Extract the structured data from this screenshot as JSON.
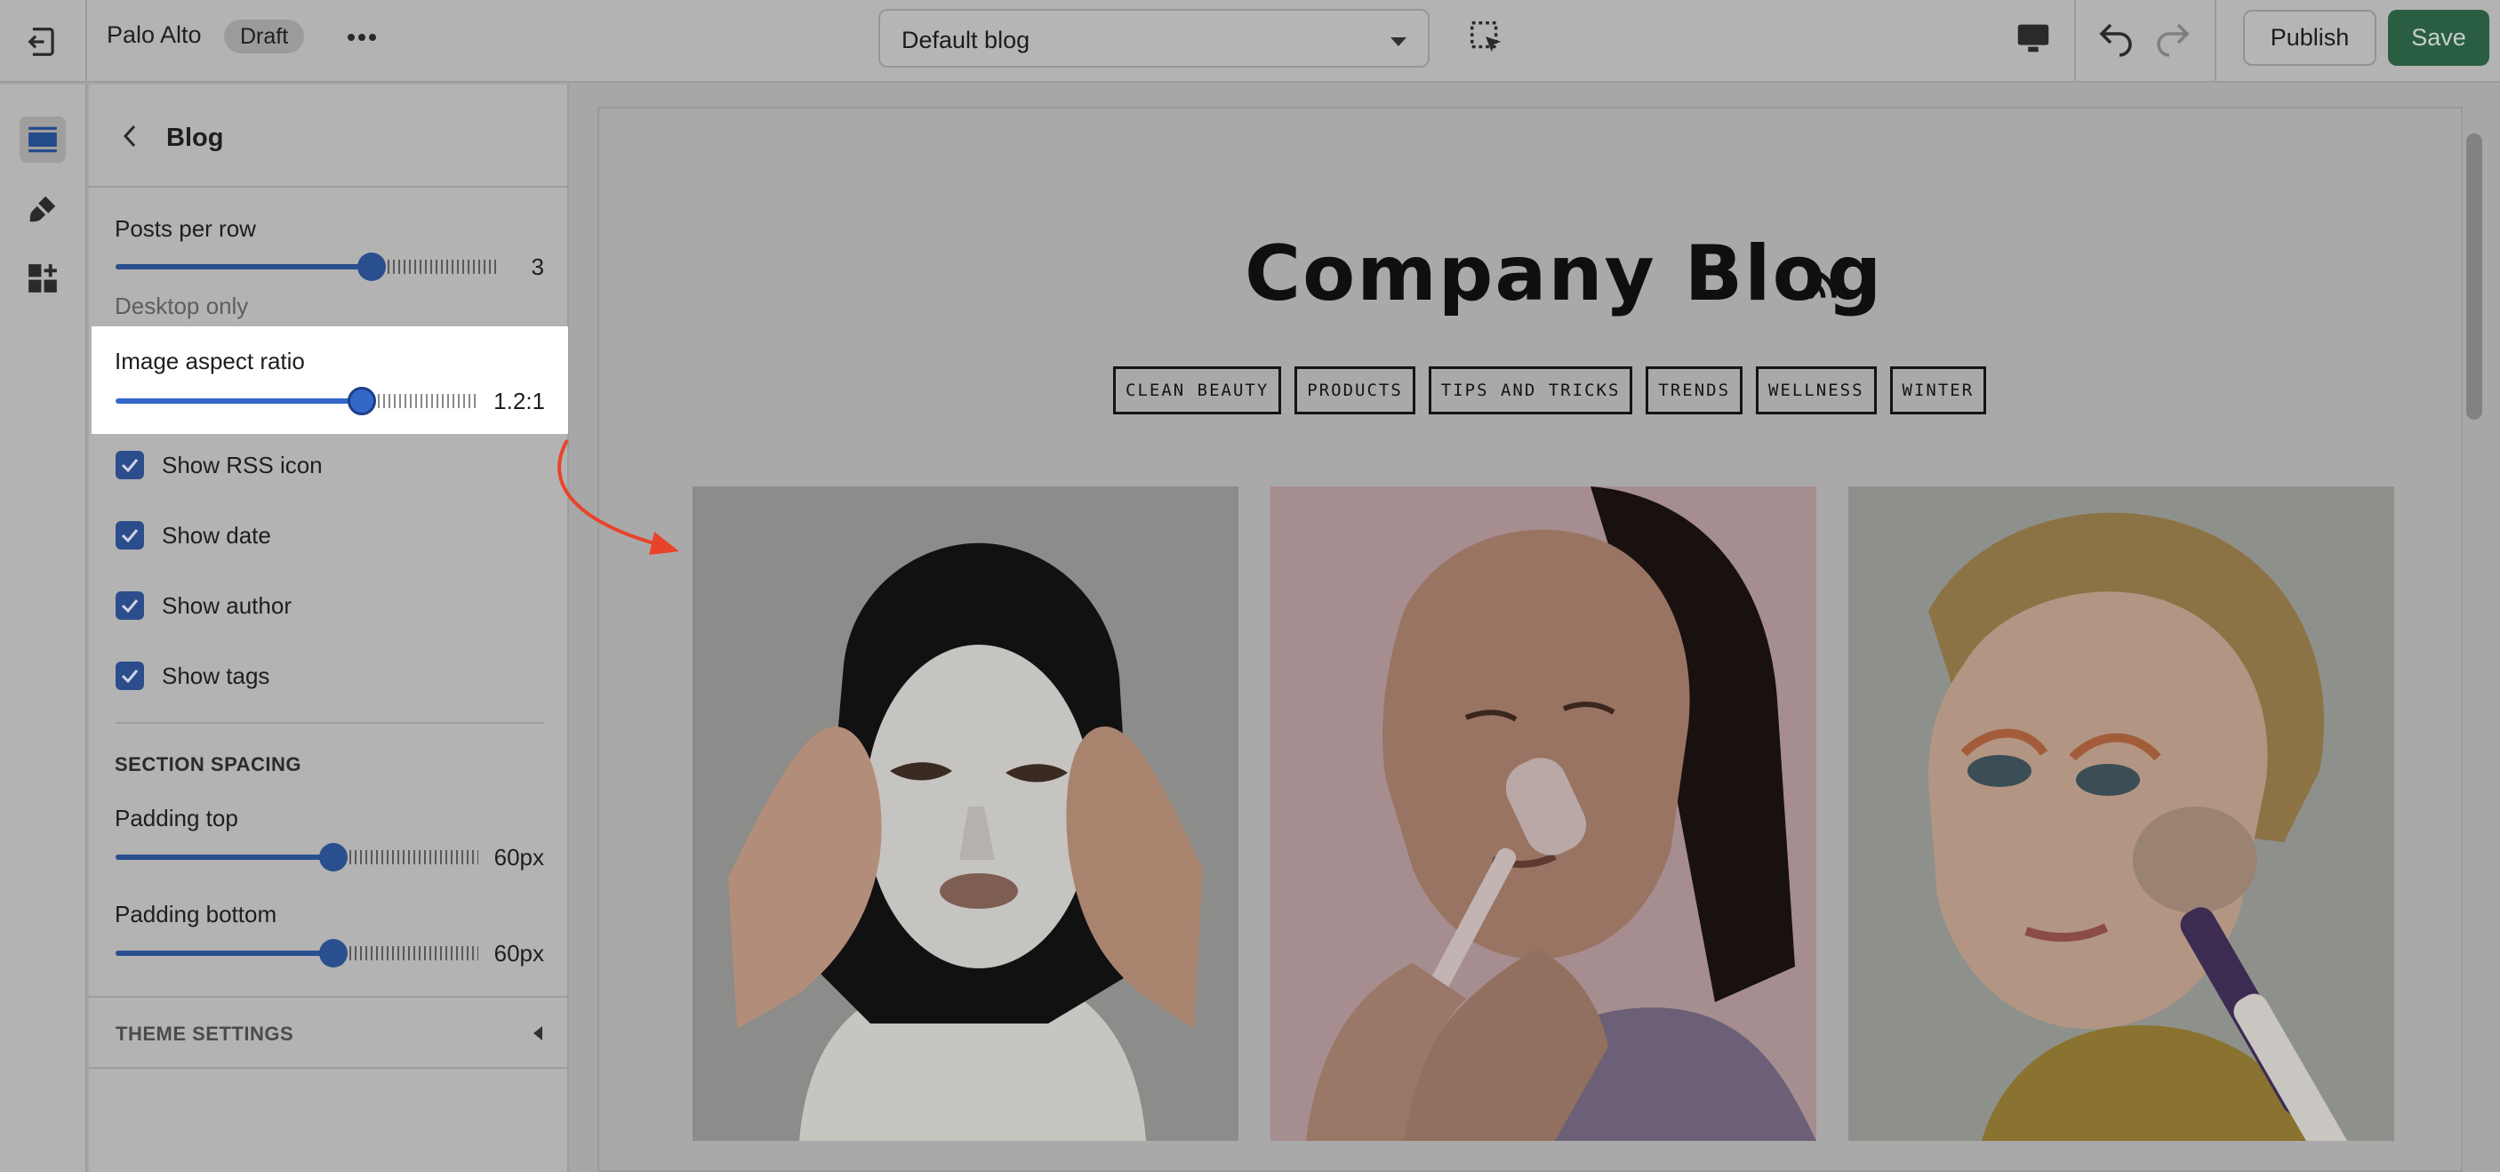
{
  "topbar": {
    "store_name": "Palo Alto",
    "status_badge": "Draft",
    "template_select": "Default blog",
    "publish_label": "Publish",
    "save_label": "Save"
  },
  "panel": {
    "title": "Blog",
    "posts_per_row": {
      "label": "Posts per row",
      "value": "3",
      "level": 0.67,
      "hint": "Desktop only"
    },
    "image_aspect_ratio": {
      "label": "Image aspect ratio",
      "value": "1.2:1",
      "level": 0.68
    },
    "checkboxes": [
      {
        "label": "Show RSS icon",
        "checked": true
      },
      {
        "label": "Show date",
        "checked": true
      },
      {
        "label": "Show author",
        "checked": true
      },
      {
        "label": "Show tags",
        "checked": true
      }
    ],
    "section_spacing": {
      "heading": "SECTION SPACING",
      "padding_top": {
        "label": "Padding top",
        "value": "60px",
        "level": 0.6
      },
      "padding_bottom": {
        "label": "Padding bottom",
        "value": "60px",
        "level": 0.6
      }
    },
    "theme_settings": "THEME SETTINGS"
  },
  "preview": {
    "blog_title": "Company Blog",
    "tags": [
      "CLEAN BEAUTY",
      "PRODUCTS",
      "TIPS AND TRICKS",
      "TRENDS",
      "WELLNESS",
      "WINTER"
    ]
  },
  "colors": {
    "save": "#2a5e43",
    "slider": "#3468c8",
    "annotation_arrow": "#e8442a"
  }
}
